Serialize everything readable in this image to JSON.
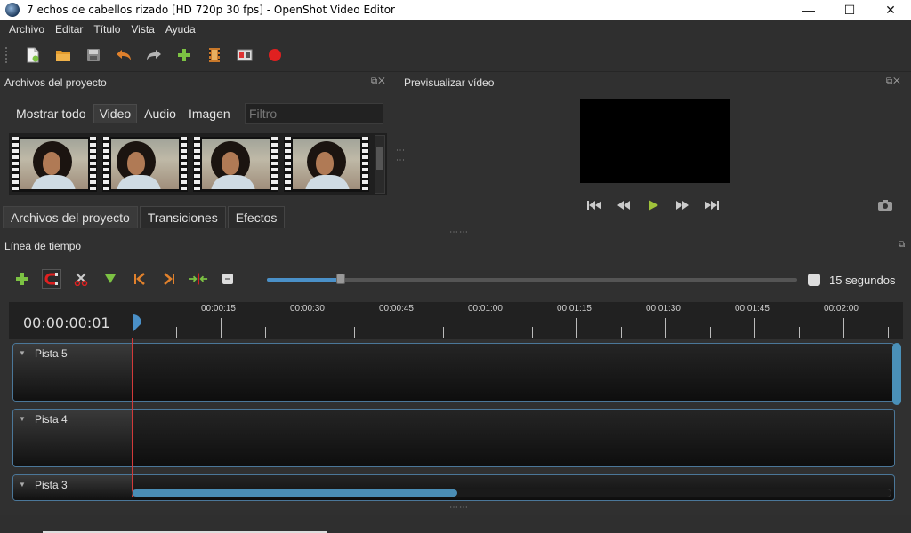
{
  "window": {
    "title": "7  echos de cabellos  rizado [HD 720p 30 fps] - OpenShot Video Editor",
    "minimize": "—",
    "maximize": "☐",
    "close": "✕"
  },
  "menu": [
    "Archivo",
    "Editar",
    "Título",
    "Vista",
    "Ayuda"
  ],
  "toolbar": {
    "icons": [
      "new-project-icon",
      "open-project-icon",
      "save-project-icon",
      "undo-icon",
      "redo-icon",
      "import-files-icon",
      "profile-icon",
      "fullscreen-icon",
      "record-icon"
    ]
  },
  "project_files": {
    "title": "Archivos del proyecto",
    "filters": [
      "Mostrar todo",
      "Video",
      "Audio",
      "Imagen"
    ],
    "active_filter": "Video",
    "filter_placeholder": "Filtro",
    "thumbnails": 4
  },
  "bottom_tabs": [
    "Archivos del proyecto",
    "Transiciones",
    "Efectos"
  ],
  "preview": {
    "title": "Previsualizar vídeo",
    "controls": [
      "jump-start-icon",
      "rewind-icon",
      "play-icon",
      "fast-forward-icon",
      "jump-end-icon"
    ]
  },
  "timeline": {
    "title": "Línea de tiempo",
    "zoom_label": "15 segundos",
    "zoom_value": 0.14,
    "timecode": "00:00:00:01",
    "tick_labels": [
      "00:00:15",
      "00:00:30",
      "00:00:45",
      "00:01:00",
      "00:01:15",
      "00:01:30",
      "00:01:45",
      "00:02:00"
    ],
    "tracks": [
      "Pista 5",
      "Pista 4",
      "Pista 3"
    ]
  },
  "colors": {
    "accent_blue": "#4a90c8",
    "playhead_red": "#d23a3a",
    "add_green": "#7cc243",
    "record_red": "#e02020"
  }
}
